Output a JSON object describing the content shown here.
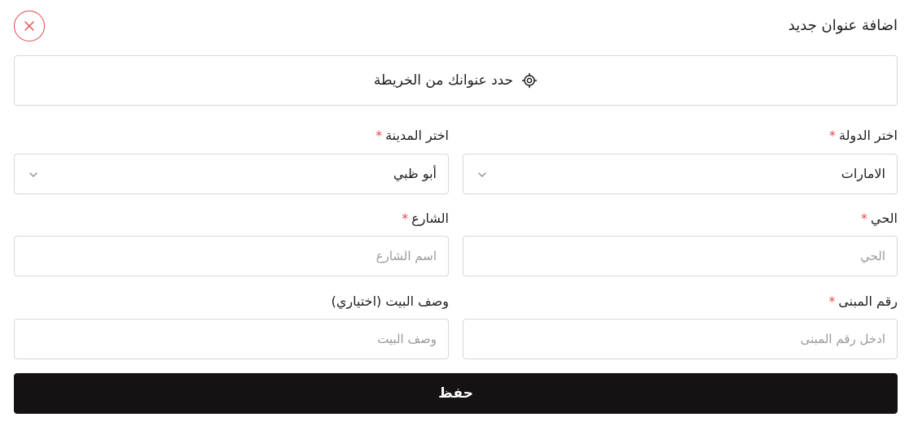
{
  "header": {
    "title": "اضافة عنوان جديد",
    "close_icon": "close-icon"
  },
  "map": {
    "label": "حدد عنوانك من الخريطة",
    "icon": "location-target-icon"
  },
  "fields": {
    "country": {
      "label": "اختر الدولة",
      "required_mark": "*",
      "value": "الامارات"
    },
    "city": {
      "label": "اختر المدينة",
      "required_mark": "*",
      "value": "أبو ظبي"
    },
    "district": {
      "label": "الحي",
      "required_mark": "*",
      "placeholder": "الحي"
    },
    "street": {
      "label": "الشارع",
      "required_mark": "*",
      "placeholder": "اسم الشارع"
    },
    "building": {
      "label": "رقم المبنى",
      "required_mark": "*",
      "placeholder": "ادخل رقم المبنى"
    },
    "house_desc": {
      "label": "وصف البيت (اختياري)",
      "placeholder": "وصف البيت"
    }
  },
  "actions": {
    "save_label": "حفظ"
  },
  "colors": {
    "accent_red": "#e5484d",
    "button_dark": "#141212",
    "border": "#d8d8d8"
  }
}
